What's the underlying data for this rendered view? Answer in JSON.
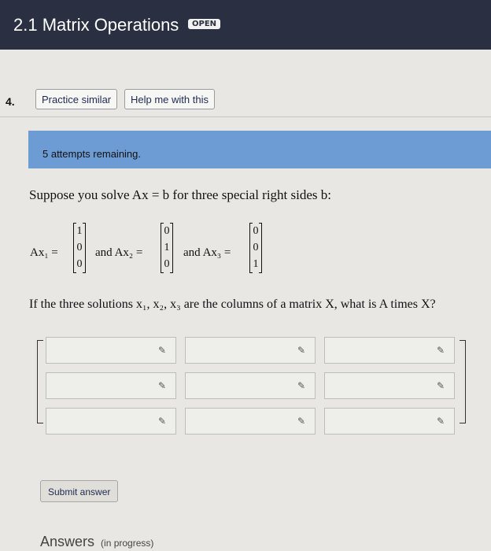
{
  "header": {
    "title": "2.1 Matrix Operations",
    "badge": "OPEN"
  },
  "question": {
    "number": "4.",
    "practice_label": "Practice similar",
    "help_label": "Help me with this",
    "attempts": "5 attempts remaining.",
    "prompt": "Suppose you solve Ax = b for three special right sides b:",
    "equations": [
      {
        "label": "Ax₁ =",
        "vector": [
          "1",
          "0",
          "0"
        ]
      },
      {
        "label": "and Ax₂ =",
        "vector": [
          "0",
          "1",
          "0"
        ]
      },
      {
        "label": "and Ax₃ =",
        "vector": [
          "0",
          "0",
          "1"
        ]
      }
    ],
    "ask": "If the three solutions x₁, x₂, x₃ are the columns of a matrix X, what is A times X?"
  },
  "matrix_inputs": {
    "rows": 3,
    "cols": 3,
    "values": [
      [
        "",
        "",
        ""
      ],
      [
        "",
        "",
        ""
      ],
      [
        "",
        "",
        ""
      ]
    ],
    "edit_icon": "pencil-icon"
  },
  "submit_label": "Submit answer",
  "answers": {
    "label": "Answers",
    "status": "(in progress)"
  }
}
